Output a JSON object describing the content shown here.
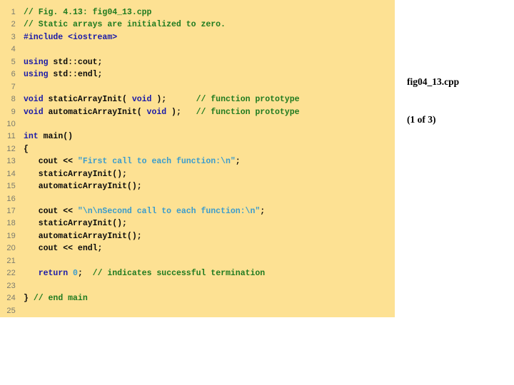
{
  "panel": {
    "background_color": "#fde193",
    "line_number_color": "#7b7b6e"
  },
  "syntax_colors": {
    "comment": "#1f7a1f",
    "keyword": "#1a1aa8",
    "string": "#3b9ccc",
    "number": "#3b9ccc",
    "plain": "#0b0b0b"
  },
  "caption": {
    "filename": "fig04_13.cpp",
    "pagination": "(1 of 3)"
  },
  "code": {
    "lines": [
      {
        "no": "1",
        "tokens": [
          {
            "t": "// Fig. 4.13: fig04_13.cpp",
            "c": "c-com"
          }
        ]
      },
      {
        "no": "2",
        "tokens": [
          {
            "t": "// Static arrays are initialized to zero.",
            "c": "c-com"
          }
        ]
      },
      {
        "no": "3",
        "tokens": [
          {
            "t": "#include <iostream>",
            "c": "c-key"
          }
        ]
      },
      {
        "no": "4",
        "tokens": []
      },
      {
        "no": "5",
        "tokens": [
          {
            "t": "using",
            "c": "c-key"
          },
          {
            "t": " std::cout;",
            "c": "c-pln"
          }
        ]
      },
      {
        "no": "6",
        "tokens": [
          {
            "t": "using",
            "c": "c-key"
          },
          {
            "t": " std::endl;",
            "c": "c-pln"
          }
        ]
      },
      {
        "no": "7",
        "tokens": []
      },
      {
        "no": "8",
        "tokens": [
          {
            "t": "void",
            "c": "c-key"
          },
          {
            "t": " staticArrayInit( ",
            "c": "c-pln"
          },
          {
            "t": "void",
            "c": "c-key"
          },
          {
            "t": " );      ",
            "c": "c-pln"
          },
          {
            "t": "// function prototype",
            "c": "c-com"
          }
        ]
      },
      {
        "no": "9",
        "tokens": [
          {
            "t": "void",
            "c": "c-key"
          },
          {
            "t": " automaticArrayInit( ",
            "c": "c-pln"
          },
          {
            "t": "void",
            "c": "c-key"
          },
          {
            "t": " );   ",
            "c": "c-pln"
          },
          {
            "t": "// function prototype",
            "c": "c-com"
          }
        ]
      },
      {
        "no": "10",
        "tokens": []
      },
      {
        "no": "11",
        "tokens": [
          {
            "t": "int",
            "c": "c-key"
          },
          {
            "t": " main()",
            "c": "c-pln"
          }
        ]
      },
      {
        "no": "12",
        "tokens": [
          {
            "t": "{",
            "c": "c-pln"
          }
        ]
      },
      {
        "no": "13",
        "tokens": [
          {
            "t": "   cout << ",
            "c": "c-pln"
          },
          {
            "t": "\"First call to each function:\\n\"",
            "c": "c-str"
          },
          {
            "t": ";",
            "c": "c-pln"
          }
        ]
      },
      {
        "no": "14",
        "tokens": [
          {
            "t": "   staticArrayInit();",
            "c": "c-pln"
          }
        ]
      },
      {
        "no": "15",
        "tokens": [
          {
            "t": "   automaticArrayInit();",
            "c": "c-pln"
          }
        ]
      },
      {
        "no": "16",
        "tokens": []
      },
      {
        "no": "17",
        "tokens": [
          {
            "t": "   cout << ",
            "c": "c-pln"
          },
          {
            "t": "\"\\n\\nSecond call to each function:\\n\"",
            "c": "c-str"
          },
          {
            "t": ";",
            "c": "c-pln"
          }
        ]
      },
      {
        "no": "18",
        "tokens": [
          {
            "t": "   staticArrayInit();",
            "c": "c-pln"
          }
        ]
      },
      {
        "no": "19",
        "tokens": [
          {
            "t": "   automaticArrayInit();",
            "c": "c-pln"
          }
        ]
      },
      {
        "no": "20",
        "tokens": [
          {
            "t": "   cout << endl;",
            "c": "c-pln"
          }
        ]
      },
      {
        "no": "21",
        "tokens": []
      },
      {
        "no": "22",
        "tokens": [
          {
            "t": "   ",
            "c": "c-pln"
          },
          {
            "t": "return",
            "c": "c-key"
          },
          {
            "t": " ",
            "c": "c-pln"
          },
          {
            "t": "0",
            "c": "c-num"
          },
          {
            "t": ";  ",
            "c": "c-pln"
          },
          {
            "t": "// indicates successful termination",
            "c": "c-com"
          }
        ]
      },
      {
        "no": "23",
        "tokens": []
      },
      {
        "no": "24",
        "tokens": [
          {
            "t": "} ",
            "c": "c-pln"
          },
          {
            "t": "// end main",
            "c": "c-com"
          }
        ]
      },
      {
        "no": "25",
        "tokens": []
      }
    ]
  }
}
